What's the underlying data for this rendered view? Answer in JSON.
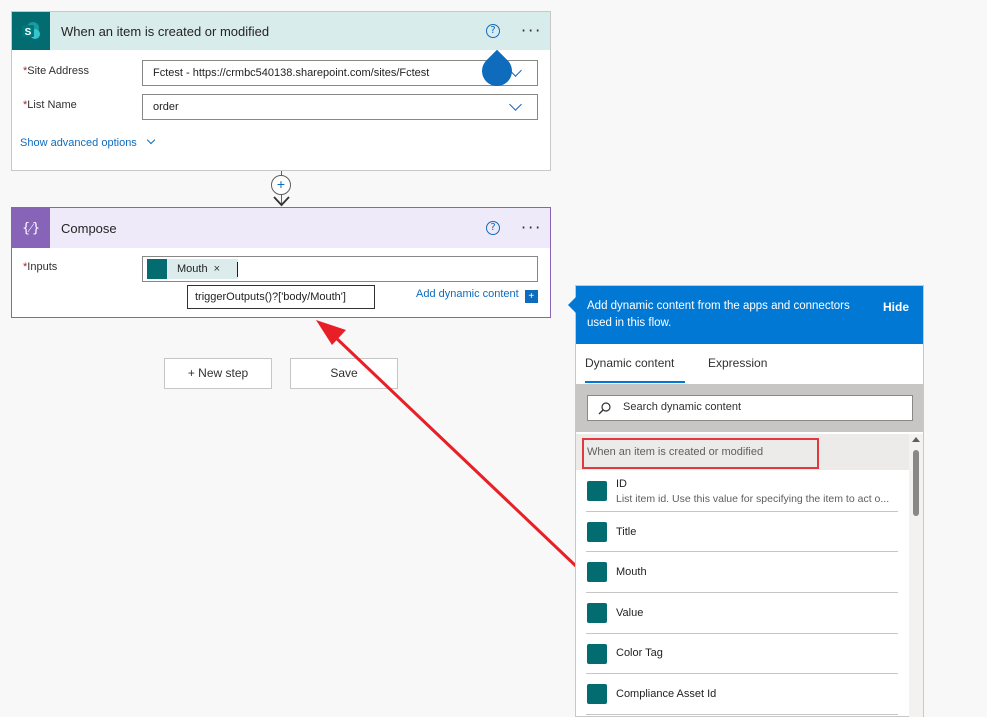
{
  "trigger": {
    "title": "When an item is created or modified",
    "site_label": "Site Address",
    "site_value": "Fctest - https://crmbc540138.sharepoint.com/sites/Fctest",
    "list_label": "List Name",
    "list_value": "order",
    "advanced_link": "Show advanced options",
    "required_marker": "*",
    "help_glyph": "?",
    "more_glyph": "···",
    "icon_letter": "S"
  },
  "compose": {
    "title": "Compose",
    "inputs_label": "Inputs",
    "token_label": "Mouth",
    "token_remove": "×",
    "add_dynamic_link": "Add dynamic content",
    "tooltip": "triggerOutputs()?['body/Mouth']",
    "icon_glyph": "{⁄}"
  },
  "actions": {
    "new_step": "+ New step",
    "save": "Save",
    "connector_plus": "+"
  },
  "panel": {
    "header_text": "Add dynamic content from the apps and connectors used in this flow.",
    "hide_label": "Hide",
    "tabs": [
      "Dynamic content",
      "Expression"
    ],
    "search_placeholder": "Search dynamic content",
    "section_title": "When an item is created or modified",
    "items": [
      {
        "name": "ID",
        "desc": "List item id. Use this value for specifying the item to act o..."
      },
      {
        "name": "Title",
        "desc": ""
      },
      {
        "name": "Mouth",
        "desc": ""
      },
      {
        "name": "Value",
        "desc": ""
      },
      {
        "name": "Color Tag",
        "desc": ""
      },
      {
        "name": "Compliance Asset Id",
        "desc": ""
      }
    ]
  },
  "colors": {
    "sharepoint_teal": "#036c70",
    "compose_purple": "#8764b8",
    "accent_blue": "#0078d4",
    "annotation_red": "#e03a3e"
  },
  "icons": [
    "sharepoint-icon",
    "compose-icon",
    "help-icon",
    "more-icon",
    "chevron-down-icon",
    "search-icon",
    "plus-icon",
    "arrow-down-icon"
  ]
}
